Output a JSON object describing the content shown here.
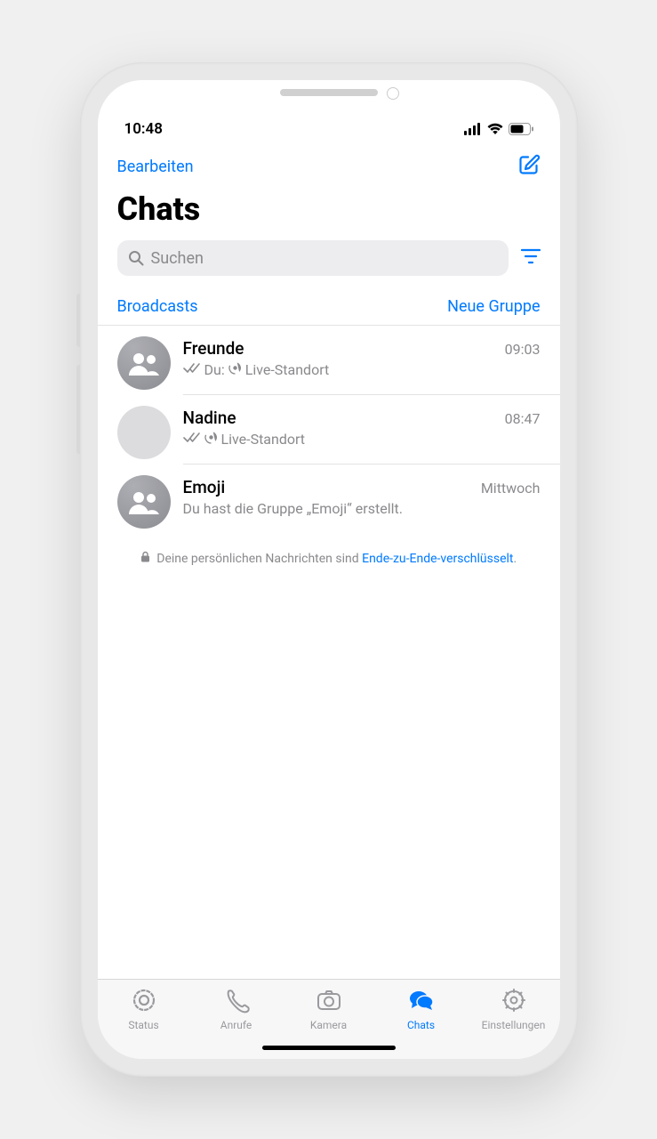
{
  "status": {
    "time": "10:48"
  },
  "nav": {
    "edit": "Bearbeiten"
  },
  "title": "Chats",
  "search": {
    "placeholder": "Suchen"
  },
  "lists": {
    "broadcasts": "Broadcasts",
    "new_group": "Neue Gruppe"
  },
  "chats": [
    {
      "name": "Freunde",
      "time": "09:03",
      "avatar": "group",
      "ticks": true,
      "prefix": "Du:",
      "location_icon": true,
      "message": "Live-Standort"
    },
    {
      "name": "Nadine",
      "time": "08:47",
      "avatar": "blank",
      "ticks": true,
      "prefix": "",
      "location_icon": true,
      "message": "Live-Standort"
    },
    {
      "name": "Emoji",
      "time": "Mittwoch",
      "avatar": "group",
      "ticks": false,
      "prefix": "",
      "location_icon": false,
      "message": "Du hast die Gruppe „Emoji“ erstellt."
    }
  ],
  "encryption": {
    "text1": "Deine persönlichen Nachrichten sind ",
    "link": "Ende-zu-Ende-verschlüsselt",
    "text2": "."
  },
  "tabs": [
    {
      "label": "Status",
      "icon": "status-icon",
      "active": false
    },
    {
      "label": "Anrufe",
      "icon": "calls-icon",
      "active": false
    },
    {
      "label": "Kamera",
      "icon": "camera-icon",
      "active": false
    },
    {
      "label": "Chats",
      "icon": "chats-icon",
      "active": true
    },
    {
      "label": "Einstellungen",
      "icon": "settings-icon",
      "active": false
    }
  ]
}
